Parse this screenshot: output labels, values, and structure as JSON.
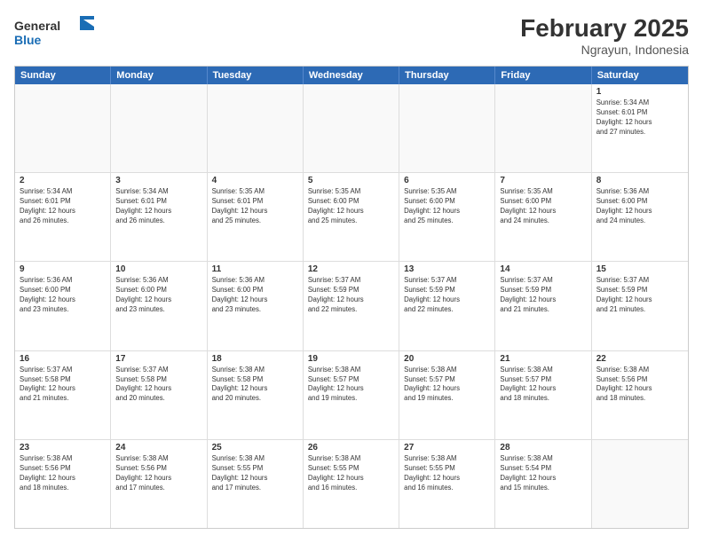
{
  "logo": {
    "general": "General",
    "blue": "Blue"
  },
  "title": {
    "month": "February 2025",
    "location": "Ngrayun, Indonesia"
  },
  "calendar": {
    "headers": [
      "Sunday",
      "Monday",
      "Tuesday",
      "Wednesday",
      "Thursday",
      "Friday",
      "Saturday"
    ],
    "rows": [
      [
        {
          "day": "",
          "info": ""
        },
        {
          "day": "",
          "info": ""
        },
        {
          "day": "",
          "info": ""
        },
        {
          "day": "",
          "info": ""
        },
        {
          "day": "",
          "info": ""
        },
        {
          "day": "",
          "info": ""
        },
        {
          "day": "1",
          "info": "Sunrise: 5:34 AM\nSunset: 6:01 PM\nDaylight: 12 hours\nand 27 minutes."
        }
      ],
      [
        {
          "day": "2",
          "info": "Sunrise: 5:34 AM\nSunset: 6:01 PM\nDaylight: 12 hours\nand 26 minutes."
        },
        {
          "day": "3",
          "info": "Sunrise: 5:34 AM\nSunset: 6:01 PM\nDaylight: 12 hours\nand 26 minutes."
        },
        {
          "day": "4",
          "info": "Sunrise: 5:35 AM\nSunset: 6:01 PM\nDaylight: 12 hours\nand 25 minutes."
        },
        {
          "day": "5",
          "info": "Sunrise: 5:35 AM\nSunset: 6:00 PM\nDaylight: 12 hours\nand 25 minutes."
        },
        {
          "day": "6",
          "info": "Sunrise: 5:35 AM\nSunset: 6:00 PM\nDaylight: 12 hours\nand 25 minutes."
        },
        {
          "day": "7",
          "info": "Sunrise: 5:35 AM\nSunset: 6:00 PM\nDaylight: 12 hours\nand 24 minutes."
        },
        {
          "day": "8",
          "info": "Sunrise: 5:36 AM\nSunset: 6:00 PM\nDaylight: 12 hours\nand 24 minutes."
        }
      ],
      [
        {
          "day": "9",
          "info": "Sunrise: 5:36 AM\nSunset: 6:00 PM\nDaylight: 12 hours\nand 23 minutes."
        },
        {
          "day": "10",
          "info": "Sunrise: 5:36 AM\nSunset: 6:00 PM\nDaylight: 12 hours\nand 23 minutes."
        },
        {
          "day": "11",
          "info": "Sunrise: 5:36 AM\nSunset: 6:00 PM\nDaylight: 12 hours\nand 23 minutes."
        },
        {
          "day": "12",
          "info": "Sunrise: 5:37 AM\nSunset: 5:59 PM\nDaylight: 12 hours\nand 22 minutes."
        },
        {
          "day": "13",
          "info": "Sunrise: 5:37 AM\nSunset: 5:59 PM\nDaylight: 12 hours\nand 22 minutes."
        },
        {
          "day": "14",
          "info": "Sunrise: 5:37 AM\nSunset: 5:59 PM\nDaylight: 12 hours\nand 21 minutes."
        },
        {
          "day": "15",
          "info": "Sunrise: 5:37 AM\nSunset: 5:59 PM\nDaylight: 12 hours\nand 21 minutes."
        }
      ],
      [
        {
          "day": "16",
          "info": "Sunrise: 5:37 AM\nSunset: 5:58 PM\nDaylight: 12 hours\nand 21 minutes."
        },
        {
          "day": "17",
          "info": "Sunrise: 5:37 AM\nSunset: 5:58 PM\nDaylight: 12 hours\nand 20 minutes."
        },
        {
          "day": "18",
          "info": "Sunrise: 5:38 AM\nSunset: 5:58 PM\nDaylight: 12 hours\nand 20 minutes."
        },
        {
          "day": "19",
          "info": "Sunrise: 5:38 AM\nSunset: 5:57 PM\nDaylight: 12 hours\nand 19 minutes."
        },
        {
          "day": "20",
          "info": "Sunrise: 5:38 AM\nSunset: 5:57 PM\nDaylight: 12 hours\nand 19 minutes."
        },
        {
          "day": "21",
          "info": "Sunrise: 5:38 AM\nSunset: 5:57 PM\nDaylight: 12 hours\nand 18 minutes."
        },
        {
          "day": "22",
          "info": "Sunrise: 5:38 AM\nSunset: 5:56 PM\nDaylight: 12 hours\nand 18 minutes."
        }
      ],
      [
        {
          "day": "23",
          "info": "Sunrise: 5:38 AM\nSunset: 5:56 PM\nDaylight: 12 hours\nand 18 minutes."
        },
        {
          "day": "24",
          "info": "Sunrise: 5:38 AM\nSunset: 5:56 PM\nDaylight: 12 hours\nand 17 minutes."
        },
        {
          "day": "25",
          "info": "Sunrise: 5:38 AM\nSunset: 5:55 PM\nDaylight: 12 hours\nand 17 minutes."
        },
        {
          "day": "26",
          "info": "Sunrise: 5:38 AM\nSunset: 5:55 PM\nDaylight: 12 hours\nand 16 minutes."
        },
        {
          "day": "27",
          "info": "Sunrise: 5:38 AM\nSunset: 5:55 PM\nDaylight: 12 hours\nand 16 minutes."
        },
        {
          "day": "28",
          "info": "Sunrise: 5:38 AM\nSunset: 5:54 PM\nDaylight: 12 hours\nand 15 minutes."
        },
        {
          "day": "",
          "info": ""
        }
      ]
    ]
  }
}
